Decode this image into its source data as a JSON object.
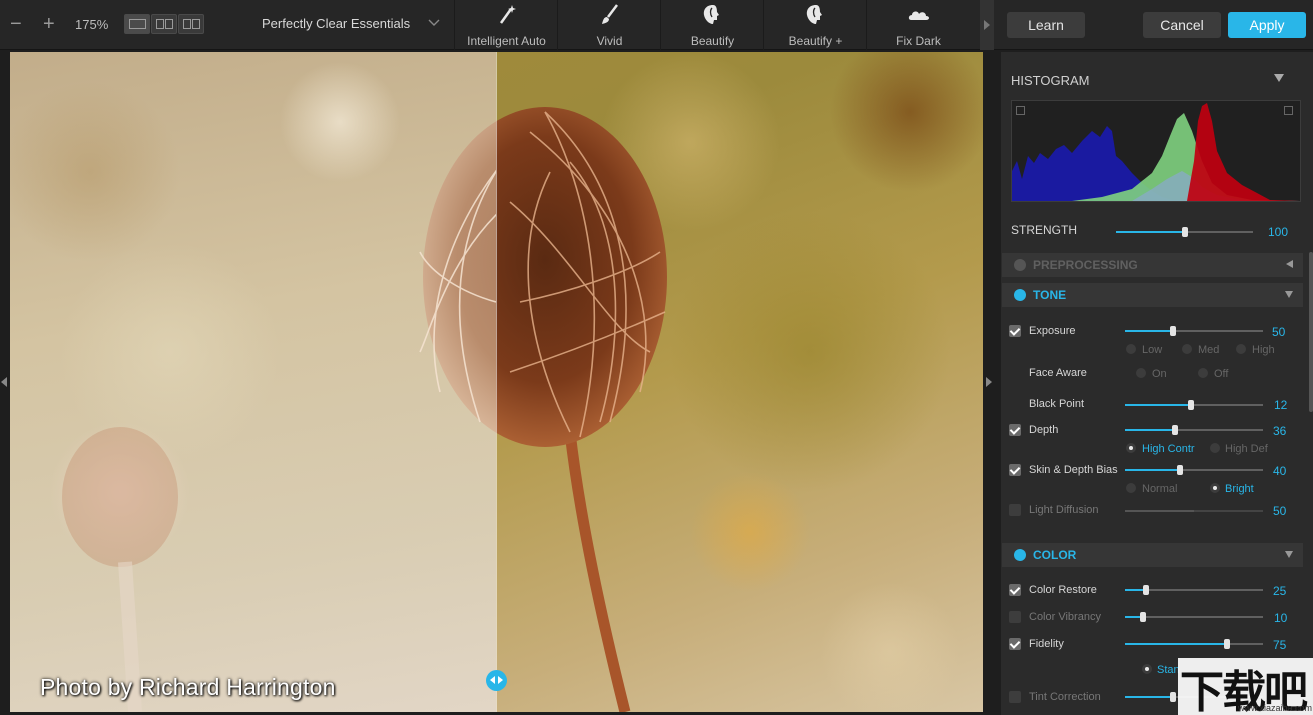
{
  "toolbar": {
    "zoom_level": "175%",
    "preset_name": "Perfectly Clear Essentials",
    "presets": [
      "Intelligent Auto",
      "Vivid",
      "Beautify",
      "Beautify +",
      "Fix Dark"
    ],
    "learn_label": "Learn",
    "cancel_label": "Cancel",
    "apply_label": "Apply"
  },
  "photo": {
    "credit": "Photo by Richard Harrington"
  },
  "panel": {
    "histogram_title": "HISTOGRAM",
    "strength": {
      "label": "STRENGTH",
      "value": "100",
      "fraction": 0.5
    },
    "preprocessing_title": "PREPROCESSING",
    "tone": {
      "title": "TONE",
      "exposure": {
        "label": "Exposure",
        "value": "50",
        "fraction": 0.35,
        "checked": true,
        "options": [
          "Low",
          "Med",
          "High"
        ]
      },
      "face_aware": {
        "label": "Face Aware",
        "options": [
          "On",
          "Off"
        ]
      },
      "black_point": {
        "label": "Black Point",
        "value": "12",
        "fraction": 0.48
      },
      "depth": {
        "label": "Depth",
        "value": "36",
        "fraction": 0.36,
        "checked": true,
        "options": [
          "High Contr",
          "High Def"
        ],
        "selected": "High Contr"
      },
      "skin_depth_bias": {
        "label": "Skin & Depth Bias",
        "value": "40",
        "fraction": 0.4,
        "checked": true,
        "options": [
          "Normal",
          "Bright"
        ],
        "selected": "Bright"
      },
      "light_diffusion": {
        "label": "Light Diffusion",
        "value": "50",
        "fraction": 0.5,
        "checked": false
      }
    },
    "color": {
      "title": "COLOR",
      "color_restore": {
        "label": "Color Restore",
        "value": "25",
        "fraction": 0.15,
        "checked": true
      },
      "color_vibrancy": {
        "label": "Color Vibrancy",
        "value": "10",
        "fraction": 0.13,
        "checked": false
      },
      "fidelity": {
        "label": "Fidelity",
        "value": "75",
        "fraction": 0.74,
        "checked": true,
        "option_partial": "Stan"
      },
      "tint_correction": {
        "label": "Tint Correction",
        "checked": false
      }
    }
  },
  "watermark": {
    "logo": "下载吧",
    "url": "www.xiazaiba.com"
  },
  "colors": {
    "accent": "#29b6e8",
    "histogram_blue": "#1a1aa0",
    "histogram_green": "#7fd27f",
    "histogram_red": "#c00010"
  }
}
